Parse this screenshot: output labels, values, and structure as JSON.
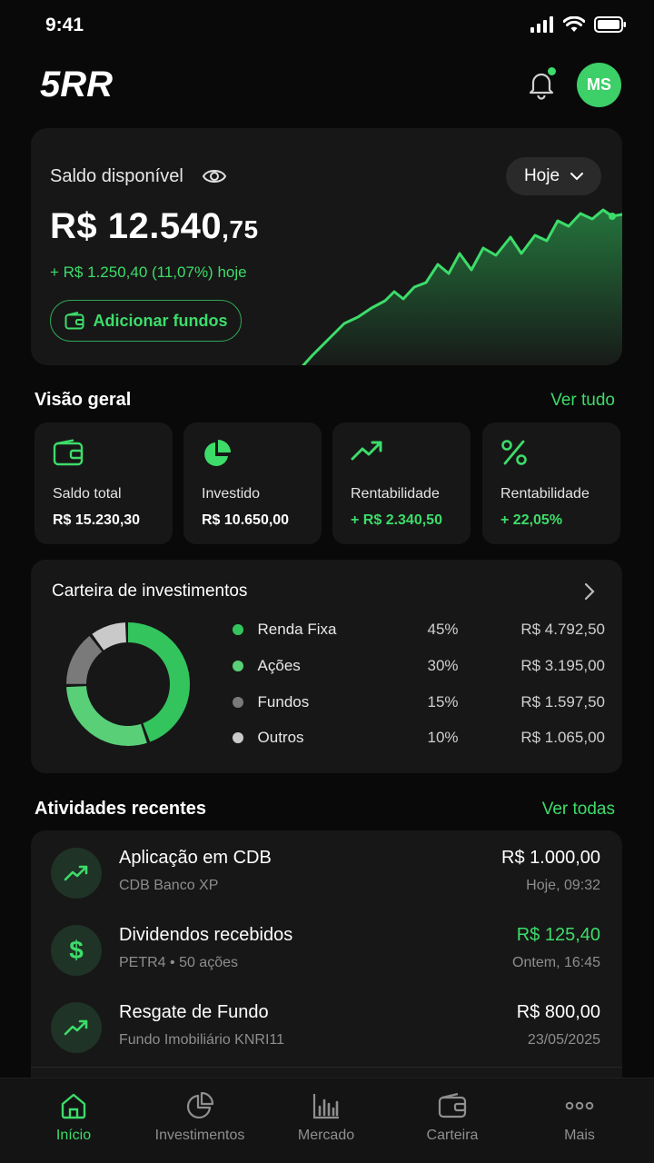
{
  "status": {
    "time": "9:41"
  },
  "header": {
    "logo_text": "5RR",
    "avatar_initials": "MS",
    "has_notification": true
  },
  "balance": {
    "label": "Saldo disponível",
    "period": "Hoje",
    "amount_main": "R$ 12.540",
    "amount_cents": ",75",
    "change": "+ R$ 1.250,40 (11,07%) hoje",
    "add_funds_label": "Adicionar fundos"
  },
  "overview": {
    "title": "Visão geral",
    "link": "Ver tudo",
    "cards": [
      {
        "label": "Saldo total",
        "value": "R$ 15.230,30",
        "icon": "wallet-icon"
      },
      {
        "label": "Investido",
        "value": "R$ 10.650,00",
        "icon": "pie-chart-icon"
      },
      {
        "label": "Rentabilidade",
        "value": "+ R$ 2.340,50",
        "icon": "trend-up-icon"
      },
      {
        "label": "Rentabilidade",
        "value": "+ 22,05%",
        "icon": "percent-icon"
      }
    ]
  },
  "portfolio": {
    "title": "Carteira de investimentos",
    "items": [
      {
        "name": "Renda Fixa",
        "pct": "45%",
        "value": "R$ 4.792,50",
        "share": 45,
        "color": "#33c45e"
      },
      {
        "name": "Ações",
        "pct": "30%",
        "value": "R$ 3.195,00",
        "share": 30,
        "color": "#59cf78"
      },
      {
        "name": "Fundos",
        "pct": "15%",
        "value": "R$ 1.597,50",
        "share": 15,
        "color": "#7a7a7a"
      },
      {
        "name": "Outros",
        "pct": "10%",
        "value": "R$ 1.065,00",
        "share": 10,
        "color": "#c9c9c9"
      }
    ]
  },
  "activities": {
    "title": "Atividades recentes",
    "link": "Ver todas",
    "items": [
      {
        "title": "Aplicação em CDB",
        "subtitle": "CDB Banco XP",
        "amount": "R$ 1.000,00",
        "date": "Hoje, 09:32",
        "icon": "trend-up-icon"
      },
      {
        "title": "Dividendos recebidos",
        "subtitle": "PETR4 • 50 ações",
        "amount": "R$ 125,40",
        "date": "Ontem, 16:45",
        "icon": "dollar-icon"
      },
      {
        "title": "Resgate de Fundo",
        "subtitle": "Fundo Imobiliário KNRI11",
        "amount": "R$ 800,00",
        "date": "23/05/2025",
        "icon": "trend-up-icon"
      }
    ]
  },
  "nav": {
    "items": [
      {
        "label": "Início",
        "icon": "home-icon",
        "active": true
      },
      {
        "label": "Investimentos",
        "icon": "pie-chart-icon"
      },
      {
        "label": "Mercado",
        "icon": "bar-chart-icon"
      },
      {
        "label": "Carteira",
        "icon": "wallet-icon"
      },
      {
        "label": "Mais",
        "icon": "more-icon"
      }
    ]
  },
  "colors": {
    "accent": "#3ddc6a",
    "background": "#090909",
    "card": "#171717"
  }
}
